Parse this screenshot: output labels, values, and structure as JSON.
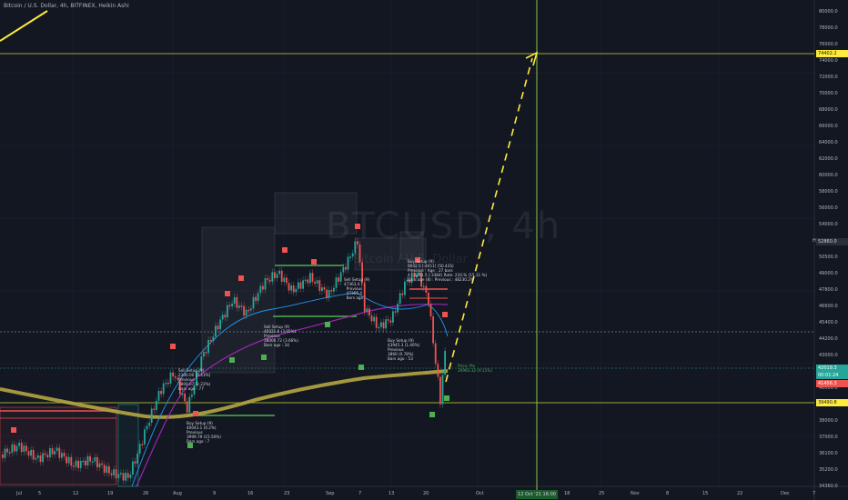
{
  "header": {
    "title": "Bitcoin / U.S. Dollar, 4h, BITFINEX, Heikin Ashi"
  },
  "watermark": {
    "symbol": "BTCUSD, 4h",
    "subtitle": "Bitcoin / U.S. Dollar"
  },
  "high_label": "High",
  "y_ticks": [
    "80000.0",
    "78000.0",
    "76000.0",
    "74000.0",
    "72000.0",
    "70000.0",
    "68000.0",
    "66000.0",
    "64000.0",
    "62000.0",
    "60000.0",
    "58000.0",
    "56000.0",
    "54000.0",
    "52000.0",
    "50500.0",
    "49000.0",
    "47800.0",
    "46600.0",
    "45400.0",
    "44200.0",
    "43000.0",
    "41800.0",
    "40000.0",
    "39000.0",
    "38000.0",
    "37000.0",
    "36100.0",
    "35200.0",
    "34360.0"
  ],
  "x_ticks": [
    "Jul",
    "5",
    "12",
    "19",
    "26",
    "Aug",
    "9",
    "16",
    "23",
    "Sep",
    "7",
    "13",
    "20",
    "Oct",
    "18",
    "25",
    "Nov",
    "8",
    "15",
    "22",
    "Dec",
    "7"
  ],
  "price_labels": {
    "target": "74402.2",
    "high": "52860.0",
    "last": "42019.3",
    "last_sub": "00:01:24",
    "red": "41456.3",
    "support": "39490.8"
  },
  "date_box": "12 Oct '21   16:00",
  "notes": {
    "buy_setup": "Buy Setup (9)\n9042.5 [-4411] (50.42S)\nPrevious : Age : 27 bars\n4 - 2281.5 [-3384] Rate: 210.% (15.11 %)\nBars age (8) : Previous : 48230.2%",
    "sell_setup_1": "Sell Setup (9)\n47363.4 [\n  Previous\n  47365.4\n  Bars ago",
    "sell_setup_2": "Buy Setup (9)\n43945.3 (1.46%)\nPrevious\n3860 (0.78%)\nBars ago : 53",
    "sell_setup_3": "Sell Setup (9)\n2300.00 [5.43%]\nPrevious\n2800.07 (2.22%)\nBars ago : 77",
    "sell_setup_4": "Sell Setup (9)\n45021.6 (3.95%)\nPrevious\n38000.72 (3.66%)\nBars ago : 34",
    "buy_setup_2": "Buy Setup (9)\n40043.1 (0.2%)\nPrevious\n3999.79 (15.50%)\nBars ago : 7",
    "price_pos": "Price: Pie\n26983.32 (9.11%)"
  },
  "chart_data": {
    "type": "candlestick",
    "symbol": "BTCUSD",
    "interval": "4h",
    "exchange": "BITFINEX",
    "ylim": [
      34360,
      80000
    ],
    "target_price": 74402.2,
    "support_price": 39490.8,
    "high_price": 52860.0,
    "last_price": 42019.3,
    "colors": {
      "background": "#131722",
      "up": "#26a69a",
      "down": "#ef5350",
      "projection": "#ffeb3b",
      "crosshair": "#8bc34a",
      "ma_long": "#b5a642",
      "ma_purple": "#9c27b0",
      "ma_blue": "#2196f3"
    }
  }
}
